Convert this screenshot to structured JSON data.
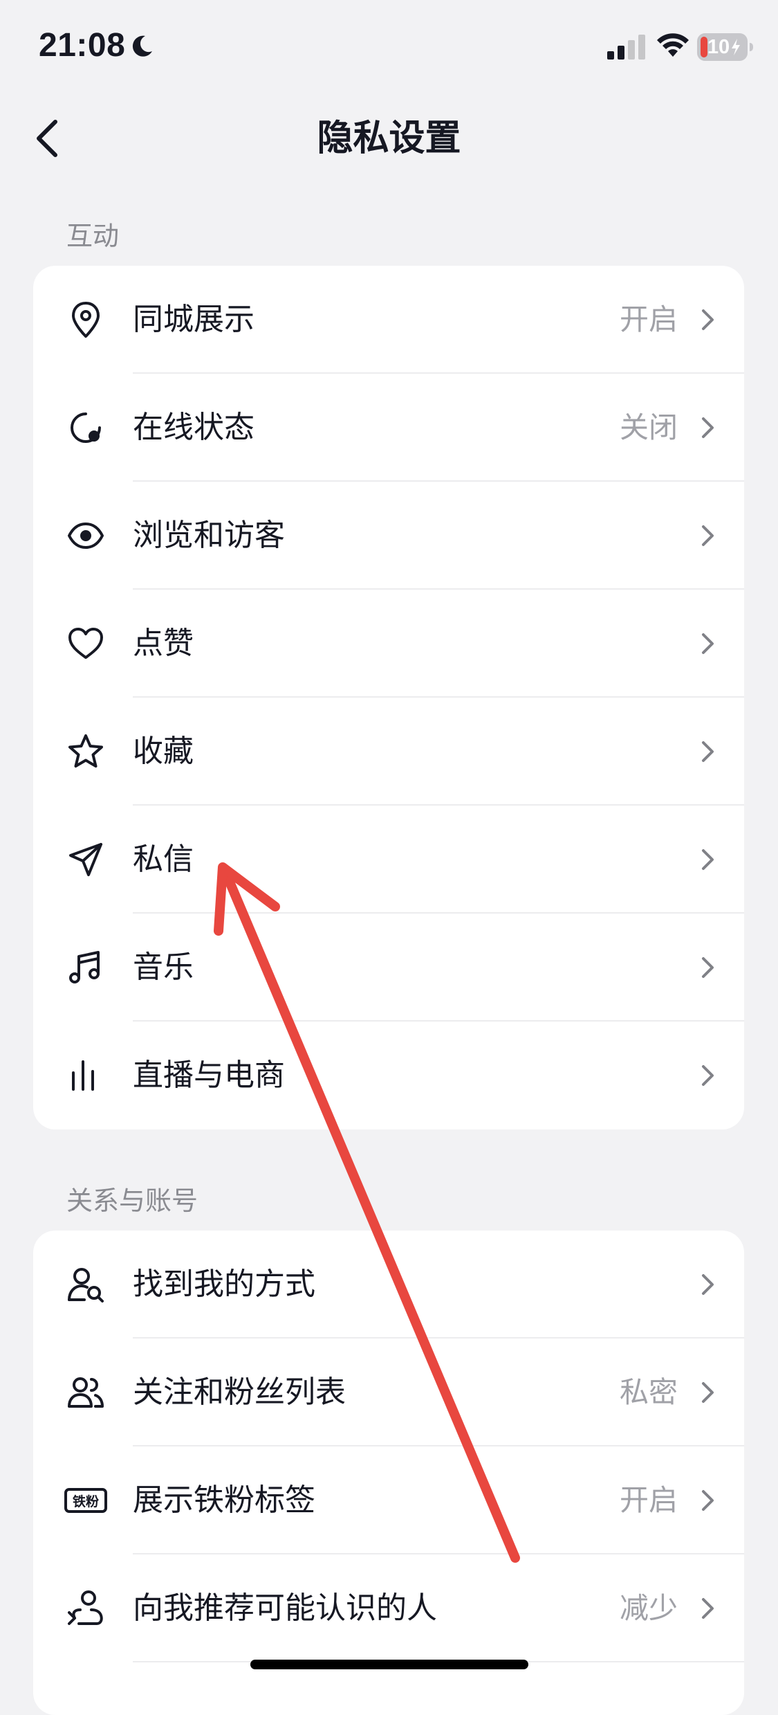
{
  "status_bar": {
    "time": "21:08",
    "battery_level": "10",
    "icons": [
      "moon-icon",
      "signal-icon",
      "wifi-icon",
      "battery-icon"
    ]
  },
  "nav": {
    "title": "隐私设置",
    "back_icon": "chevron-left-icon"
  },
  "sections": [
    {
      "header": "互动",
      "items": [
        {
          "label": "同城展示",
          "value": "开启",
          "icon": "location-pin-icon"
        },
        {
          "label": "在线状态",
          "value": "关闭",
          "icon": "online-status-icon"
        },
        {
          "label": "浏览和访客",
          "value": "",
          "icon": "eye-icon"
        },
        {
          "label": "点赞",
          "value": "",
          "icon": "heart-icon"
        },
        {
          "label": "收藏",
          "value": "",
          "icon": "star-icon"
        },
        {
          "label": "私信",
          "value": "",
          "icon": "paper-plane-icon"
        },
        {
          "label": "音乐",
          "value": "",
          "icon": "music-note-icon"
        },
        {
          "label": "直播与电商",
          "value": "",
          "icon": "bars-icon"
        }
      ]
    },
    {
      "header": "关系与账号",
      "items": [
        {
          "label": "找到我的方式",
          "value": "",
          "icon": "user-search-icon"
        },
        {
          "label": "关注和粉丝列表",
          "value": "私密",
          "icon": "users-icon"
        },
        {
          "label": "展示铁粉标签",
          "value": "开启",
          "icon": "fan-badge-icon",
          "badge_text": "铁粉"
        },
        {
          "label": "向我推荐可能认识的人",
          "value": "减少",
          "icon": "user-recommend-icon"
        }
      ]
    }
  ],
  "colors": {
    "background": "#f2f2f4",
    "card": "#ffffff",
    "text": "#161823",
    "secondary_text": "#a0a1a7",
    "annotation": "#e8473f"
  }
}
